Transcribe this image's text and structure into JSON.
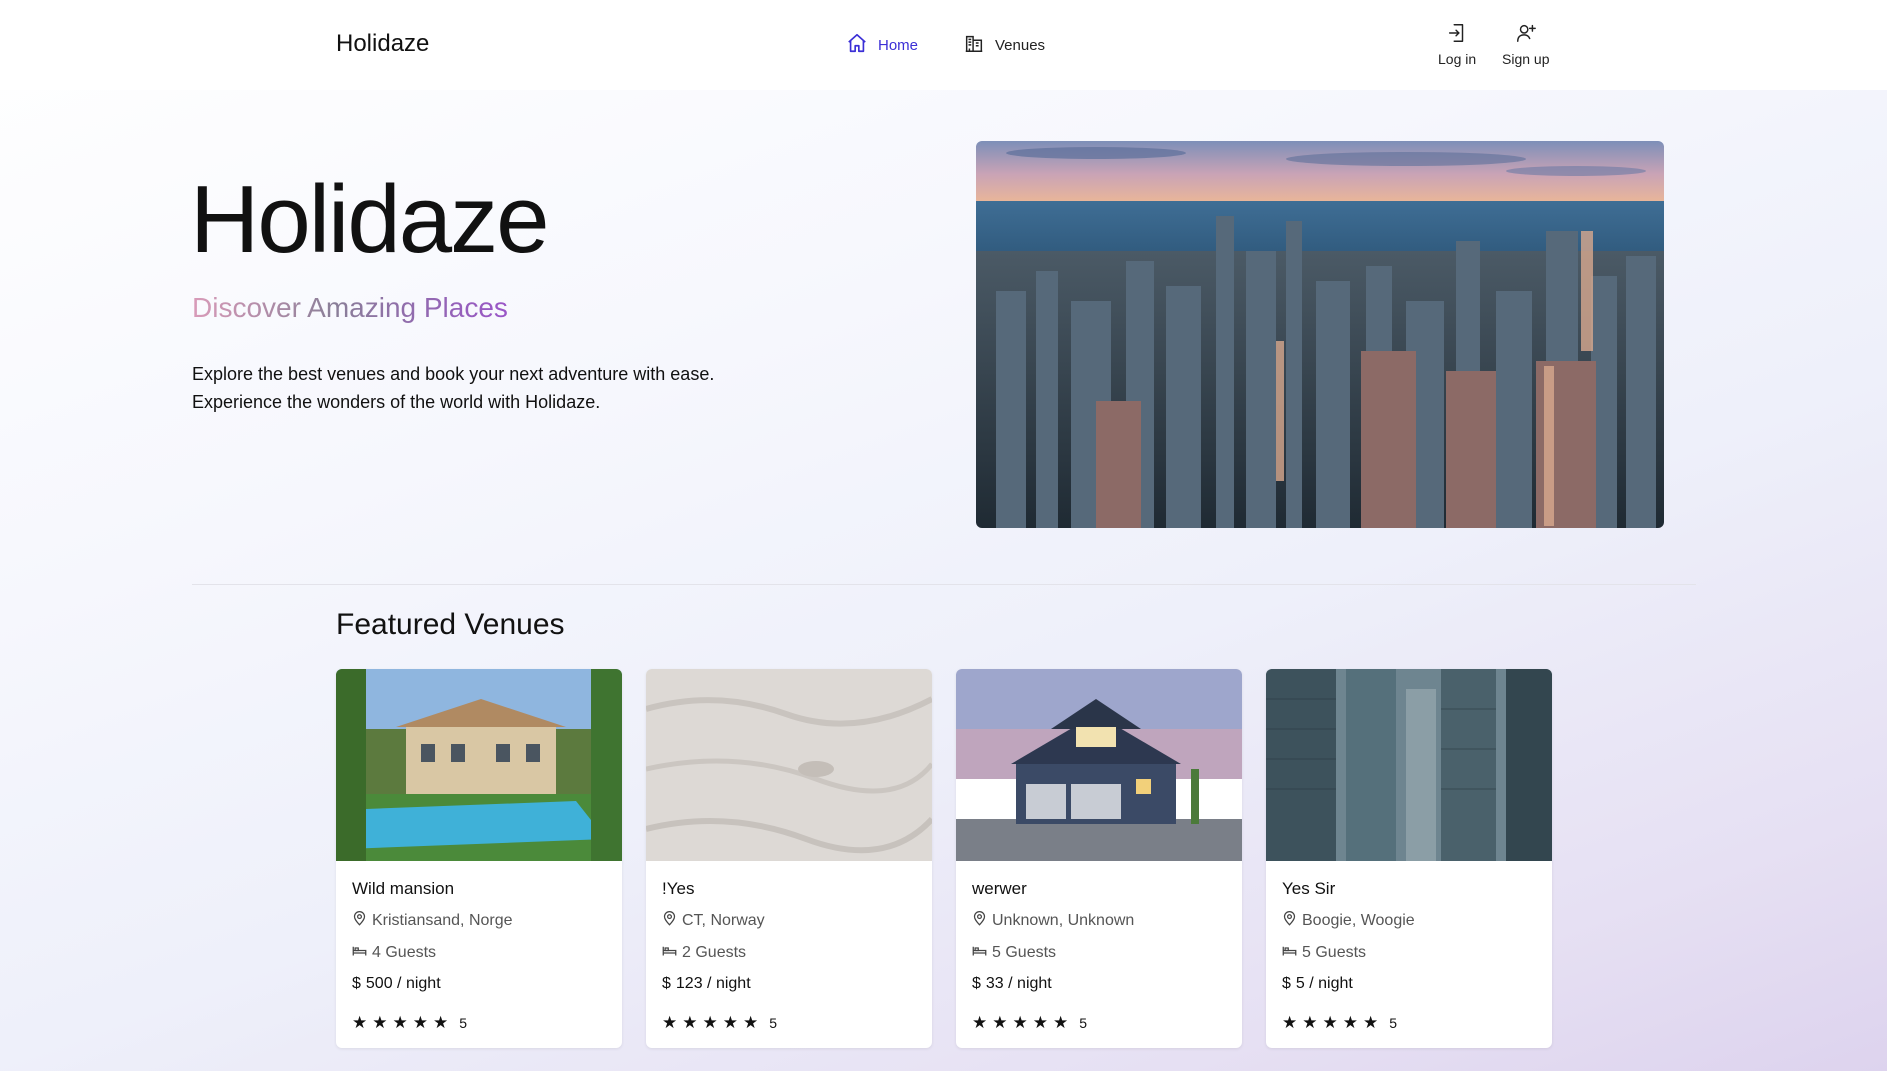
{
  "nav": {
    "brand": "Holidaze",
    "home_label": "Home",
    "venues_label": "Venues",
    "login_label": "Log in",
    "signup_label": "Sign up"
  },
  "hero": {
    "title": "Holidaze",
    "subtitle": "Discover Amazing Places",
    "description": "Explore the best venues and book your next adventure with ease. Experience the wonders of the world with Holidaze."
  },
  "featured": {
    "title": "Featured Venues",
    "venues": [
      {
        "name": "Wild mansion",
        "location": "Kristiansand, Norge",
        "guests": "4 Guests",
        "price": "500 / night",
        "rating": "5",
        "stars": 5
      },
      {
        "name": "!Yes",
        "location": "CT, Norway",
        "guests": "2 Guests",
        "price": "123 / night",
        "rating": "5",
        "stars": 5
      },
      {
        "name": "werwer",
        "location": "Unknown, Unknown",
        "guests": "5 Guests",
        "price": "33 / night",
        "rating": "5",
        "stars": 5
      },
      {
        "name": "Yes Sir",
        "location": "Boogie, Woogie",
        "guests": "5 Guests",
        "price": "5 / night",
        "rating": "5",
        "stars": 5
      }
    ]
  },
  "colors": {
    "accent": "#3b2fd6",
    "subtitle_gradient": [
      "#d99bb9",
      "#8a7f98",
      "#9a55c8"
    ]
  }
}
